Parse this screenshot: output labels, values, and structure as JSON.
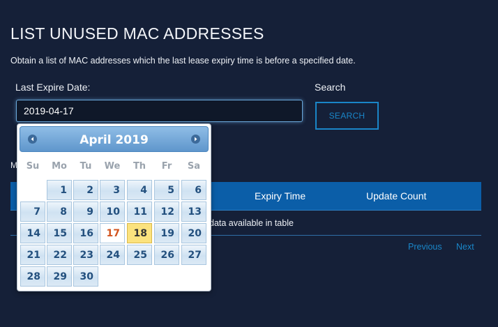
{
  "page": {
    "title": "LIST UNUSED MAC ADDRESSES",
    "description": "Obtain a list of MAC addresses which the last lease expiry time is before a specified date."
  },
  "form": {
    "date_label": "Last Expire Date:",
    "date_value": "2019-04-17",
    "search_label": "Search",
    "search_button": "SEARCH"
  },
  "table": {
    "partial_label": "M",
    "columns": [
      "Expiry Time",
      "Update Count"
    ],
    "empty_message": "data available in table",
    "pager": {
      "previous": "Previous",
      "next": "Next"
    }
  },
  "datepicker": {
    "month_title": "April 2019",
    "weekdays": [
      "Su",
      "Mo",
      "Tu",
      "We",
      "Th",
      "Fr",
      "Sa"
    ],
    "first_weekday_index": 1,
    "days_in_month": 30,
    "today": 17,
    "selected": 18,
    "prev_icon": "chevron-left-icon",
    "next_icon": "chevron-right-icon"
  },
  "colors": {
    "background": "#152038",
    "accent": "#1a86c8",
    "table_header": "#0b5ea8",
    "today_text": "#d2541e",
    "selected_day": "#fbe27e"
  }
}
